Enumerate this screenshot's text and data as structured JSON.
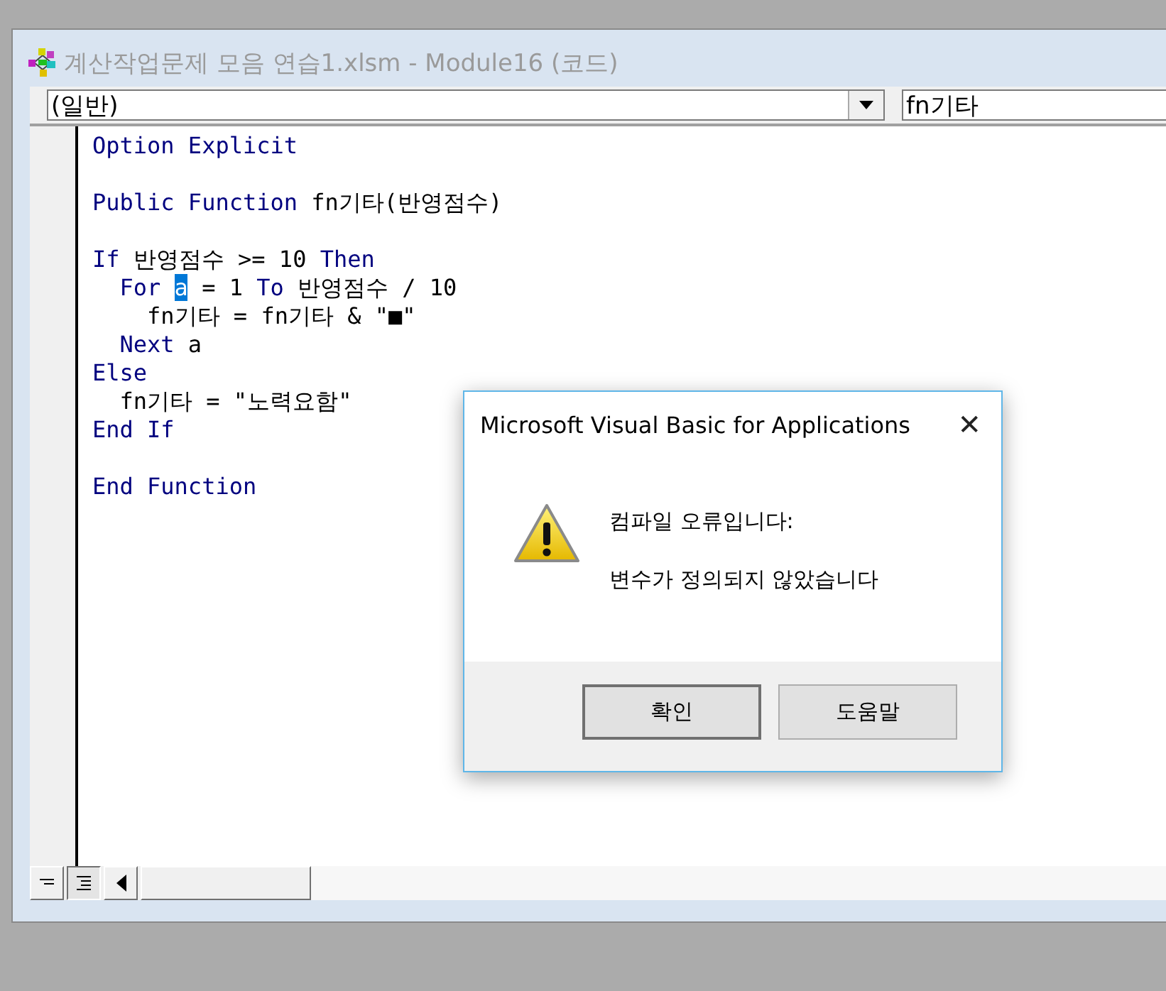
{
  "window": {
    "title": "계산작업문제 모음 연습1.xlsm - Module16 (코드)",
    "active": false
  },
  "object_box": {
    "value": "(일반)"
  },
  "procedure_box": {
    "value": "fn기타"
  },
  "code_lines": [
    {
      "kind": "code",
      "segments": [
        {
          "text": "Option Explicit",
          "kind": "keyword"
        }
      ]
    },
    {
      "kind": "blank"
    },
    {
      "kind": "code",
      "segments": [
        {
          "text": "Public Function",
          "kind": "keyword"
        },
        {
          "text": " fn기타(반영점수)",
          "kind": "plain"
        }
      ]
    },
    {
      "kind": "blank"
    },
    {
      "kind": "code",
      "segments": [
        {
          "text": "If",
          "kind": "keyword"
        },
        {
          "text": " 반영점수 >= 10 ",
          "kind": "plain"
        },
        {
          "text": "Then",
          "kind": "keyword"
        }
      ]
    },
    {
      "kind": "code",
      "segments": [
        {
          "text": "  For ",
          "kind": "keyword"
        },
        {
          "text": "a",
          "kind": "selected"
        },
        {
          "text": " = 1 ",
          "kind": "plain"
        },
        {
          "text": "To",
          "kind": "keyword"
        },
        {
          "text": " 반영점수 / 10",
          "kind": "plain"
        }
      ]
    },
    {
      "kind": "code",
      "segments": [
        {
          "text": "    fn기타 = fn기타 & \"■\"",
          "kind": "plain"
        }
      ]
    },
    {
      "kind": "code",
      "segments": [
        {
          "text": "  Next",
          "kind": "keyword"
        },
        {
          "text": " a",
          "kind": "plain"
        }
      ]
    },
    {
      "kind": "code",
      "segments": [
        {
          "text": "Else",
          "kind": "keyword"
        }
      ]
    },
    {
      "kind": "code",
      "segments": [
        {
          "text": "  fn기타 = \"노력요함\"",
          "kind": "plain"
        }
      ]
    },
    {
      "kind": "code",
      "segments": [
        {
          "text": "End If",
          "kind": "keyword"
        }
      ]
    },
    {
      "kind": "blank"
    },
    {
      "kind": "code",
      "segments": [
        {
          "text": "End Function",
          "kind": "keyword"
        }
      ]
    }
  ],
  "dialog": {
    "title": "Microsoft Visual Basic for Applications",
    "close": "✕",
    "heading": "컴파일 오류입니다:",
    "message": "변수가 정의되지 않았습니다",
    "buttons": [
      {
        "label": "확인",
        "default": true
      },
      {
        "label": "도움말",
        "default": false
      }
    ]
  },
  "view_buttons": [
    {
      "kind": "procedure",
      "selected": false
    },
    {
      "kind": "module",
      "selected": true
    }
  ]
}
